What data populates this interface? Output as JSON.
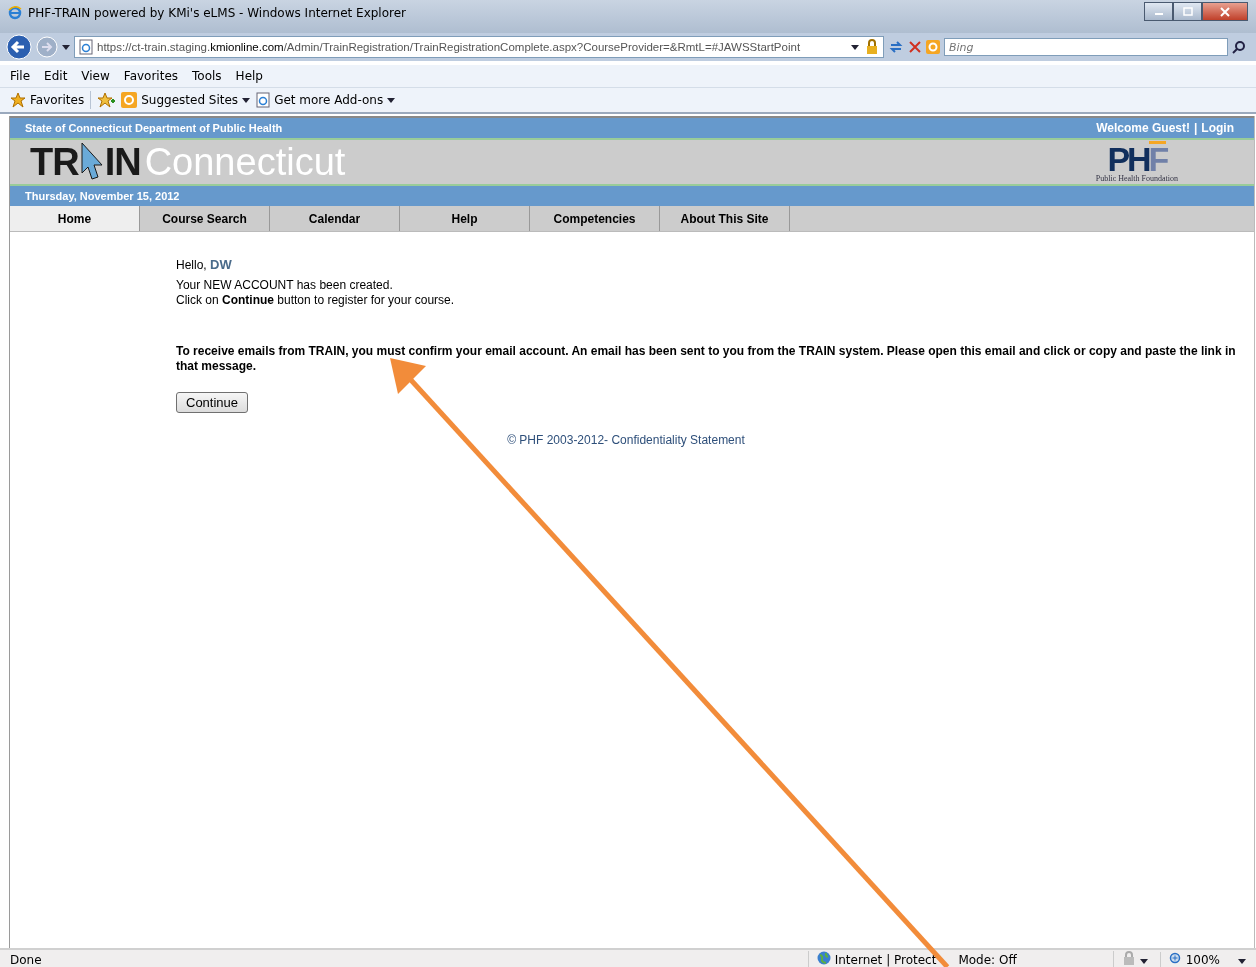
{
  "browser": {
    "title": "PHF-TRAIN powered by KMi's eLMS - Windows Internet Explorer",
    "address": {
      "prefix": "https://ct-train.staging.",
      "domain": "kmionline.com",
      "path": "/Admin/TrainRegistration/TrainRegistrationComplete.aspx?CourseProvider=&RmtL=#JAWSStartPoint"
    },
    "search": {
      "placeholder": "Bing"
    },
    "menu": [
      "File",
      "Edit",
      "View",
      "Favorites",
      "Tools",
      "Help"
    ],
    "favorites_bar": [
      {
        "kind": "star",
        "label": "Favorites"
      },
      {
        "kind": "add"
      },
      {
        "kind": "sites",
        "label": "Suggested Sites"
      },
      {
        "kind": "addons",
        "label": "Get more Add-ons"
      }
    ]
  },
  "site": {
    "agency": "State of Connecticut Department of Public Health",
    "welcome": "Welcome Guest!",
    "separator": "|",
    "login": "Login",
    "logo": {
      "left": "TR",
      "right": "IN",
      "state": "Connecticut"
    },
    "partner_logo": {
      "main": "PH",
      "last": "F",
      "caption": "Public Health Foundation"
    },
    "date": "Thursday, November 15, 2012",
    "nav": [
      {
        "label": "Home",
        "selected": true
      },
      {
        "label": "Course Search",
        "selected": false
      },
      {
        "label": "Calendar",
        "selected": false
      },
      {
        "label": "Help",
        "selected": false
      },
      {
        "label": "Competencies",
        "selected": false
      },
      {
        "label": "About This Site",
        "selected": false
      }
    ],
    "greeting": "Hello,",
    "user": "DW",
    "lines": [
      "Your NEW ACCOUNT has been created.",
      "Click on **Continue** button to register for your course."
    ],
    "notice": "To receive emails from TRAIN, you must confirm your email account. An email has been sent to you from the TRAIN system. Please open this email and click or copy and paste the link in that message.",
    "button": "Continue",
    "footer": "© PHF 2003-2012- Confidentiality Statement"
  },
  "status_bar": {
    "text": "Done",
    "zone": [
      "Internet | Protect",
      "Mode: Off"
    ],
    "zoom": "100%"
  }
}
